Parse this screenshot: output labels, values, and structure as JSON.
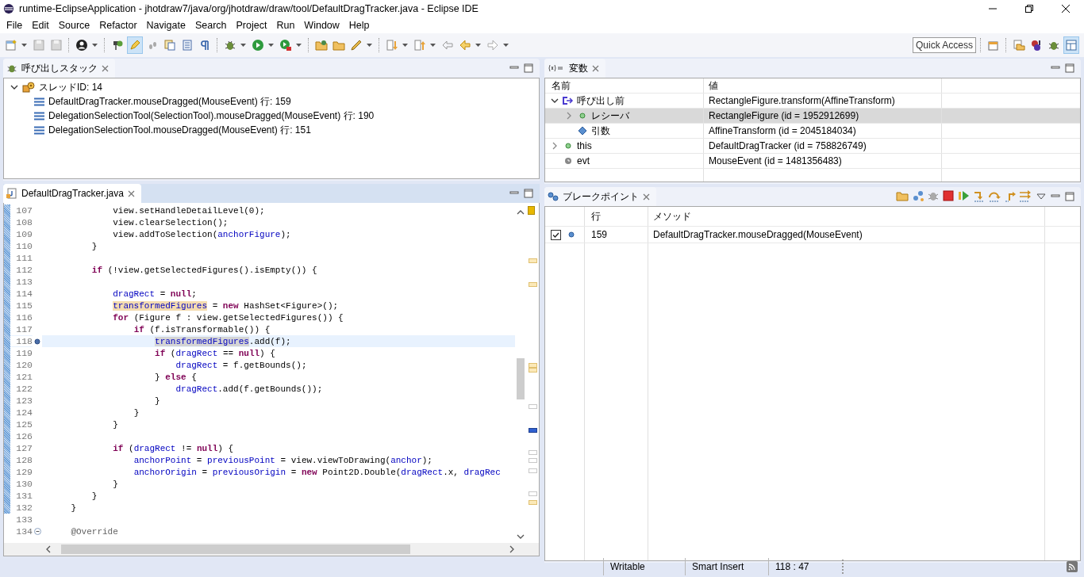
{
  "window": {
    "title": "runtime-EclipseApplication - jhotdraw7/java/org/jhotdraw/draw/tool/DefaultDragTracker.java - Eclipse IDE"
  },
  "menu": [
    "File",
    "Edit",
    "Source",
    "Refactor",
    "Navigate",
    "Search",
    "Project",
    "Run",
    "Window",
    "Help"
  ],
  "toolbar": {
    "toggle_pressed": true,
    "quick_access": "Quick Access",
    "debug_perspective_selected": true
  },
  "call_stack": {
    "tab": "呼び出しスタック",
    "thread": {
      "label": "スレッドID: 14",
      "expanded": true,
      "children": [
        {
          "label": "DefaultDragTracker.mouseDragged(MouseEvent) 行: 159"
        },
        {
          "label": "DelegationSelectionTool(SelectionTool).mouseDragged(MouseEvent) 行: 190"
        },
        {
          "label": "DelegationSelectionTool.mouseDragged(MouseEvent) 行: 151"
        }
      ]
    }
  },
  "variables": {
    "tab": "変数",
    "columns": [
      "名前",
      "値"
    ],
    "rows": [
      {
        "kind": "method-result",
        "name": "呼び出し前",
        "value": "RectangleFigure.transform(AffineTransform)",
        "expanded": true,
        "selected": false,
        "children": [
          {
            "kind": "field",
            "name": "レシーバ",
            "value": "RectangleFigure (id = 1952912699)",
            "expanded": false,
            "selected": true
          },
          {
            "kind": "argument",
            "name": "引数",
            "value": "AffineTransform (id = 2045184034)",
            "selected": false
          }
        ]
      },
      {
        "kind": "field",
        "name": "this",
        "value": "DefaultDragTracker (id = 758826749)",
        "expanded": false,
        "selected": false
      },
      {
        "kind": "local",
        "name": "evt",
        "value": "MouseEvent (id = 1481356483)",
        "selected": false
      }
    ]
  },
  "editor": {
    "tab": "DefaultDragTracker.java",
    "lines": [
      {
        "n": "107",
        "current": false,
        "breakpoint": false,
        "foldable": false,
        "tokens": [
          {
            "t": "            view.setHandleDetailLevel(0);",
            "kind": "plain"
          }
        ]
      },
      {
        "n": "108",
        "current": false,
        "breakpoint": false,
        "foldable": false,
        "tokens": [
          {
            "t": "            view.clearSelection();",
            "kind": "plain"
          }
        ]
      },
      {
        "n": "109",
        "current": false,
        "breakpoint": false,
        "foldable": false,
        "tokens": [
          {
            "t": "            view.addToSelection(",
            "kind": "plain"
          },
          {
            "t": "anchorFigure",
            "kind": "field"
          },
          {
            "t": ");",
            "kind": "plain"
          }
        ]
      },
      {
        "n": "110",
        "current": false,
        "breakpoint": false,
        "foldable": false,
        "tokens": [
          {
            "t": "        }",
            "kind": "plain"
          }
        ]
      },
      {
        "n": "111",
        "current": false,
        "breakpoint": false,
        "foldable": false
      },
      {
        "n": "112",
        "current": false,
        "breakpoint": false,
        "foldable": false,
        "tokens": [
          {
            "t": "        if",
            "kind": "keyword"
          },
          {
            "t": " (!view.getSelectedFigures().isEmpty()) {",
            "kind": "plain"
          }
        ]
      },
      {
        "n": "113",
        "current": false,
        "breakpoint": false,
        "foldable": false
      },
      {
        "n": "114",
        "current": false,
        "breakpoint": false,
        "foldable": false,
        "tokens": [
          {
            "t": "            dragRect",
            "kind": "field"
          },
          {
            "t": " = ",
            "kind": "plain"
          },
          {
            "t": "null",
            "kind": "keyword"
          },
          {
            "t": ";",
            "kind": "plain"
          }
        ]
      },
      {
        "n": "115",
        "current": false,
        "breakpoint": false,
        "foldable": false,
        "tokens": [
          {
            "t": "            transformedFigures",
            "kind": "occurrence"
          },
          {
            "t": " = ",
            "kind": "plain"
          },
          {
            "t": "new",
            "kind": "keyword"
          },
          {
            "t": " HashSet<Figure>();",
            "kind": "plain"
          }
        ]
      },
      {
        "n": "116",
        "current": false,
        "breakpoint": false,
        "foldable": false,
        "tokens": [
          {
            "t": "            for",
            "kind": "keyword"
          },
          {
            "t": " (Figure f : view.getSelectedFigures()) {",
            "kind": "plain"
          }
        ]
      },
      {
        "n": "117",
        "current": false,
        "breakpoint": false,
        "foldable": false,
        "tokens": [
          {
            "t": "                if",
            "kind": "keyword"
          },
          {
            "t": " (f.isTransformable()) {",
            "kind": "plain"
          }
        ]
      },
      {
        "n": "118",
        "current": true,
        "breakpoint": true,
        "foldable": false,
        "tokens": [
          {
            "t": "                    transformedFigures",
            "kind": "write-occurrence"
          },
          {
            "t": ".add(f);",
            "kind": "plain"
          }
        ]
      },
      {
        "n": "119",
        "current": false,
        "breakpoint": false,
        "foldable": false,
        "tokens": [
          {
            "t": "                    if",
            "kind": "keyword"
          },
          {
            "t": " (",
            "kind": "plain"
          },
          {
            "t": "dragRect",
            "kind": "field"
          },
          {
            "t": " == ",
            "kind": "plain"
          },
          {
            "t": "null",
            "kind": "keyword"
          },
          {
            "t": ") {",
            "kind": "plain"
          }
        ]
      },
      {
        "n": "120",
        "current": false,
        "breakpoint": false,
        "foldable": false,
        "tokens": [
          {
            "t": "                        dragRect",
            "kind": "field"
          },
          {
            "t": " = f.getBounds();",
            "kind": "plain"
          }
        ]
      },
      {
        "n": "121",
        "current": false,
        "breakpoint": false,
        "foldable": false,
        "tokens": [
          {
            "t": "                    } ",
            "kind": "plain"
          },
          {
            "t": "else",
            "kind": "keyword"
          },
          {
            "t": " {",
            "kind": "plain"
          }
        ]
      },
      {
        "n": "122",
        "current": false,
        "breakpoint": false,
        "foldable": false,
        "tokens": [
          {
            "t": "                        dragRect",
            "kind": "field"
          },
          {
            "t": ".add(f.getBounds());",
            "kind": "plain"
          }
        ]
      },
      {
        "n": "123",
        "current": false,
        "breakpoint": false,
        "foldable": false,
        "tokens": [
          {
            "t": "                    }",
            "kind": "plain"
          }
        ]
      },
      {
        "n": "124",
        "current": false,
        "breakpoint": false,
        "foldable": false,
        "tokens": [
          {
            "t": "                }",
            "kind": "plain"
          }
        ]
      },
      {
        "n": "125",
        "current": false,
        "breakpoint": false,
        "foldable": false,
        "tokens": [
          {
            "t": "            }",
            "kind": "plain"
          }
        ]
      },
      {
        "n": "126",
        "current": false,
        "breakpoint": false,
        "foldable": false
      },
      {
        "n": "127",
        "current": false,
        "breakpoint": false,
        "foldable": false,
        "tokens": [
          {
            "t": "            if",
            "kind": "keyword"
          },
          {
            "t": " (",
            "kind": "plain"
          },
          {
            "t": "dragRect",
            "kind": "field"
          },
          {
            "t": " != ",
            "kind": "plain"
          },
          {
            "t": "null",
            "kind": "keyword"
          },
          {
            "t": ") {",
            "kind": "plain"
          }
        ]
      },
      {
        "n": "128",
        "current": false,
        "breakpoint": false,
        "foldable": false,
        "tokens": [
          {
            "t": "                anchorPoint",
            "kind": "field"
          },
          {
            "t": " = ",
            "kind": "plain"
          },
          {
            "t": "previousPoint",
            "kind": "field"
          },
          {
            "t": " = view.viewToDrawing(",
            "kind": "plain"
          },
          {
            "t": "anchor",
            "kind": "field"
          },
          {
            "t": ");",
            "kind": "plain"
          }
        ]
      },
      {
        "n": "129",
        "current": false,
        "breakpoint": false,
        "foldable": false,
        "tokens": [
          {
            "t": "                anchorOrigin",
            "kind": "field"
          },
          {
            "t": " = ",
            "kind": "plain"
          },
          {
            "t": "previousOrigin",
            "kind": "field"
          },
          {
            "t": " = ",
            "kind": "plain"
          },
          {
            "t": "new",
            "kind": "keyword"
          },
          {
            "t": " Point2D.Double(",
            "kind": "plain"
          },
          {
            "t": "dragRect",
            "kind": "field"
          },
          {
            "t": ".x, ",
            "kind": "plain"
          },
          {
            "t": "dragRec",
            "kind": "field"
          }
        ]
      },
      {
        "n": "130",
        "current": false,
        "breakpoint": false,
        "foldable": false,
        "tokens": [
          {
            "t": "            }",
            "kind": "plain"
          }
        ]
      },
      {
        "n": "131",
        "current": false,
        "breakpoint": false,
        "foldable": false,
        "tokens": [
          {
            "t": "        }",
            "kind": "plain"
          }
        ]
      },
      {
        "n": "132",
        "current": false,
        "breakpoint": false,
        "foldable": false,
        "tokens": [
          {
            "t": "    }",
            "kind": "plain"
          }
        ]
      },
      {
        "n": "133",
        "current": false,
        "breakpoint": false,
        "foldable": false
      },
      {
        "n": "134",
        "current": false,
        "breakpoint": false,
        "foldable": true,
        "tokens": [
          {
            "t": "    @Override",
            "kind": "annotation"
          }
        ]
      }
    ]
  },
  "breakpoints": {
    "tab": "ブレークポイント",
    "columns": [
      "行",
      "メソッド"
    ],
    "rows": [
      {
        "checked": true,
        "line": "159",
        "method": "DefaultDragTracker.mouseDragged(MouseEvent)"
      }
    ]
  },
  "status_bar": [
    "Writable",
    "Smart Insert",
    "118 : 47"
  ]
}
